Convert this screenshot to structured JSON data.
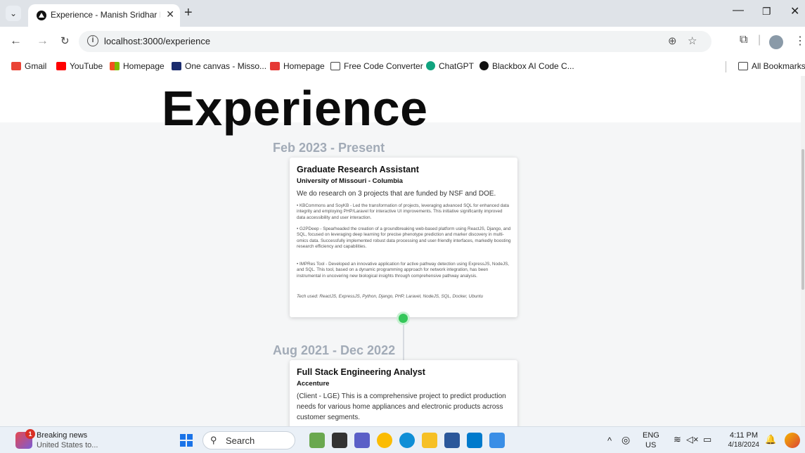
{
  "browser": {
    "tab_title": "Experience - Manish Sridhar In",
    "url": "localhost:3000/experience",
    "bookmarks": [
      {
        "label": "Gmail",
        "color": "#ea4335"
      },
      {
        "label": "YouTube",
        "color": "#ff0000"
      },
      {
        "label": "Homepage",
        "color": "#f4b400"
      },
      {
        "label": "One canvas - Misso...",
        "color": "#1a2b6d"
      },
      {
        "label": "Homepage",
        "color": "#e53935"
      },
      {
        "label": "Free Code Converter",
        "color": "#444444"
      },
      {
        "label": "ChatGPT",
        "color": "#10a37f"
      },
      {
        "label": "Blackbox AI Code C...",
        "color": "#111111"
      }
    ],
    "all_bookmarks": "All Bookmarks"
  },
  "page": {
    "heading": "Experience",
    "experiences": [
      {
        "date": "Feb 2023 - Present",
        "title": "Graduate Research Assistant",
        "org": "University of Missouri - Columbia",
        "summary": "We do research on 3 projects that are funded by NSF and DOE.",
        "bullets": [
          "• KBCommons and SoyKB - Led the transformation of projects, leveraging advanced SQL for enhanced data integrity and employing PHP/Laravel for interactive UI improvements. This initiative significantly improved data accessibility and user interaction.",
          "• G2PDeep - Spearheaded the creation of a groundbreaking web-based platform using ReactJS, Django, and SQL, focused on leveraging deep learning for precise phenotype prediction and marker discovery in multi-omics data. Successfully implemented robust data processing and user-friendly interfaces, markedly boosting research efficiency and capabilities.",
          "• IMPRes Tool - Developed an innovative application for active pathway detection using ExpressJS, NodeJS, and SQL. This tool, based on a dynamic programming approach for network integration, has been instrumental in uncovering new biological insights through comprehensive pathway analysis."
        ],
        "tech": "Tech used: ReactJS, ExpressJS, Python, Django, PHP, Laravel, NodeJS, SQL, Docker, Ubuntu"
      },
      {
        "date": "Aug 2021 - Dec 2022",
        "title": "Full Stack Engineering Analyst",
        "org": "Accenture",
        "summary": "(Client - LGE) This is a comprehensive project to predict production needs for various home appliances and electronic products across customer segments."
      }
    ],
    "accent_color": "#34c759"
  },
  "taskbar": {
    "news_title": "Breaking news",
    "news_sub": "United States to...",
    "news_badge": "1",
    "search_label": "Search",
    "lang": "ENG",
    "region": "US",
    "time": "4:11 PM",
    "date": "4/18/2024"
  }
}
